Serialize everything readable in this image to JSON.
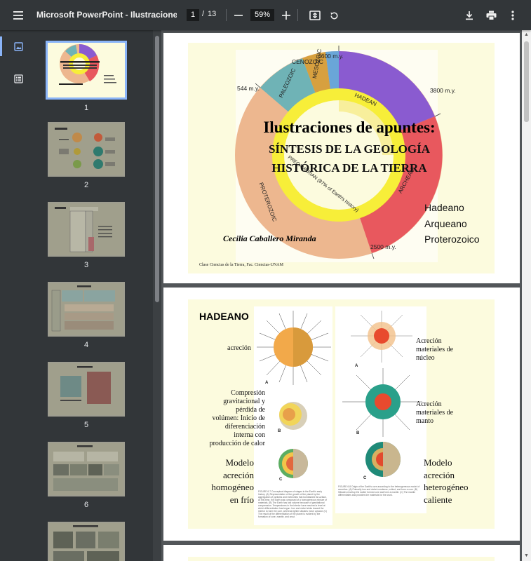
{
  "toolbar": {
    "title": "Microsoft PowerPoint - IlustracionesGg...",
    "page_current": "1",
    "page_separator": "/",
    "page_total": "13",
    "zoom": "59%",
    "icons": [
      "menu-icon",
      "minus-icon",
      "plus-icon",
      "fit-page-icon",
      "rotate-icon",
      "download-icon",
      "print-icon",
      "more-vert-icon"
    ]
  },
  "rail": {
    "icons": [
      "thumbnails-icon",
      "outline-icon"
    ]
  },
  "thumbnails": [
    {
      "number": "1"
    },
    {
      "number": "2"
    },
    {
      "number": "3"
    },
    {
      "number": "4"
    },
    {
      "number": "5"
    },
    {
      "number": "6"
    }
  ],
  "slide1": {
    "title": "Ilustraciones de apuntes:",
    "subtitle_line1": "SÍNTESIS DE LA GEOLOGÍA",
    "subtitle_line2": "HISTÓRICA DE LA TIERRA",
    "list": [
      "Hadeano",
      "Arqueano",
      "Proterozoico"
    ],
    "author": "Cecilia Caballero Miranda",
    "footer": "Clase Ciencias de la Tierra, Fac. Ciencias-UNAM",
    "eras": {
      "cenozoic": "CENOZOIC",
      "m4600": "4600 m.y.",
      "m544": "544 m.y.",
      "m3800": "3800 m.y.",
      "m2500": "2500 m.y.",
      "paleozoic": "PALEOZOIC",
      "mesozoic": "MESOZOIC",
      "hadean": "HADEAN",
      "proterozoic": "PROTEROZOIC",
      "archean": "ARCHEAN",
      "precambrian": "PRECAMBRIAN (87% of Earth's history)"
    },
    "colors": {
      "hadean": "#8a5bd0",
      "archean": "#e8585e",
      "proterozoic": "#edb78f",
      "paleozoic": "#6fb3b6",
      "mesozoic": "#d7a03f",
      "cenozoic": "#6aa6d8",
      "precambrian_ring": "#f7ee39"
    }
  },
  "slide2": {
    "heading": "HADEANO",
    "acrecion": "acreción",
    "compresion": [
      "Compresión",
      "gravitacional y",
      "pérdida de",
      "volúmen: Inicio de",
      "diferenciación",
      "interna con",
      "producción de calor"
    ],
    "modelo_homo": [
      "Modelo",
      "acreción",
      "homogéneo",
      "en frío"
    ],
    "acrecion_nucleo": [
      "Acreción",
      "materiales de",
      "núcleo"
    ],
    "acrecion_manto": [
      "Acreción",
      "materiales de",
      "manto"
    ],
    "modelo_hetero": [
      "Modelo",
      "acreción",
      "heterogéneo",
      "caliente"
    ],
    "fig_labels": {
      "a": "A",
      "b": "B",
      "c": "C"
    },
    "caption_left": "FIGURE 6-7 Conceptual diagram of stages in the Earth's early history. (A) Representation of the growth of the planet by the aggregation of particles and meteorites that bombarded its surface. At this time, the Earth was composed of a homogeneous mixture of materials. (B) The Earth has lost volume because of gravitational compression. Temperatures in the interior have reached a level at which differentiation has begun. Iron and nickel sinks toward the interior to form the core, whereas lighter silicates move upward. (C) The result of the differentiation of the planet is evident by the formation of core, mantle, and crust.",
    "caption_right": "FIGURE 6-8 Origin of the Earth's core according to the heterogeneous model of accretion. (A) Primarily iron and nickel condense, collect, and form a core. (B) Silicates envelop the earlier formed core and form a mantle. (C) The mantle differentiates and provides the materials for the crust."
  }
}
